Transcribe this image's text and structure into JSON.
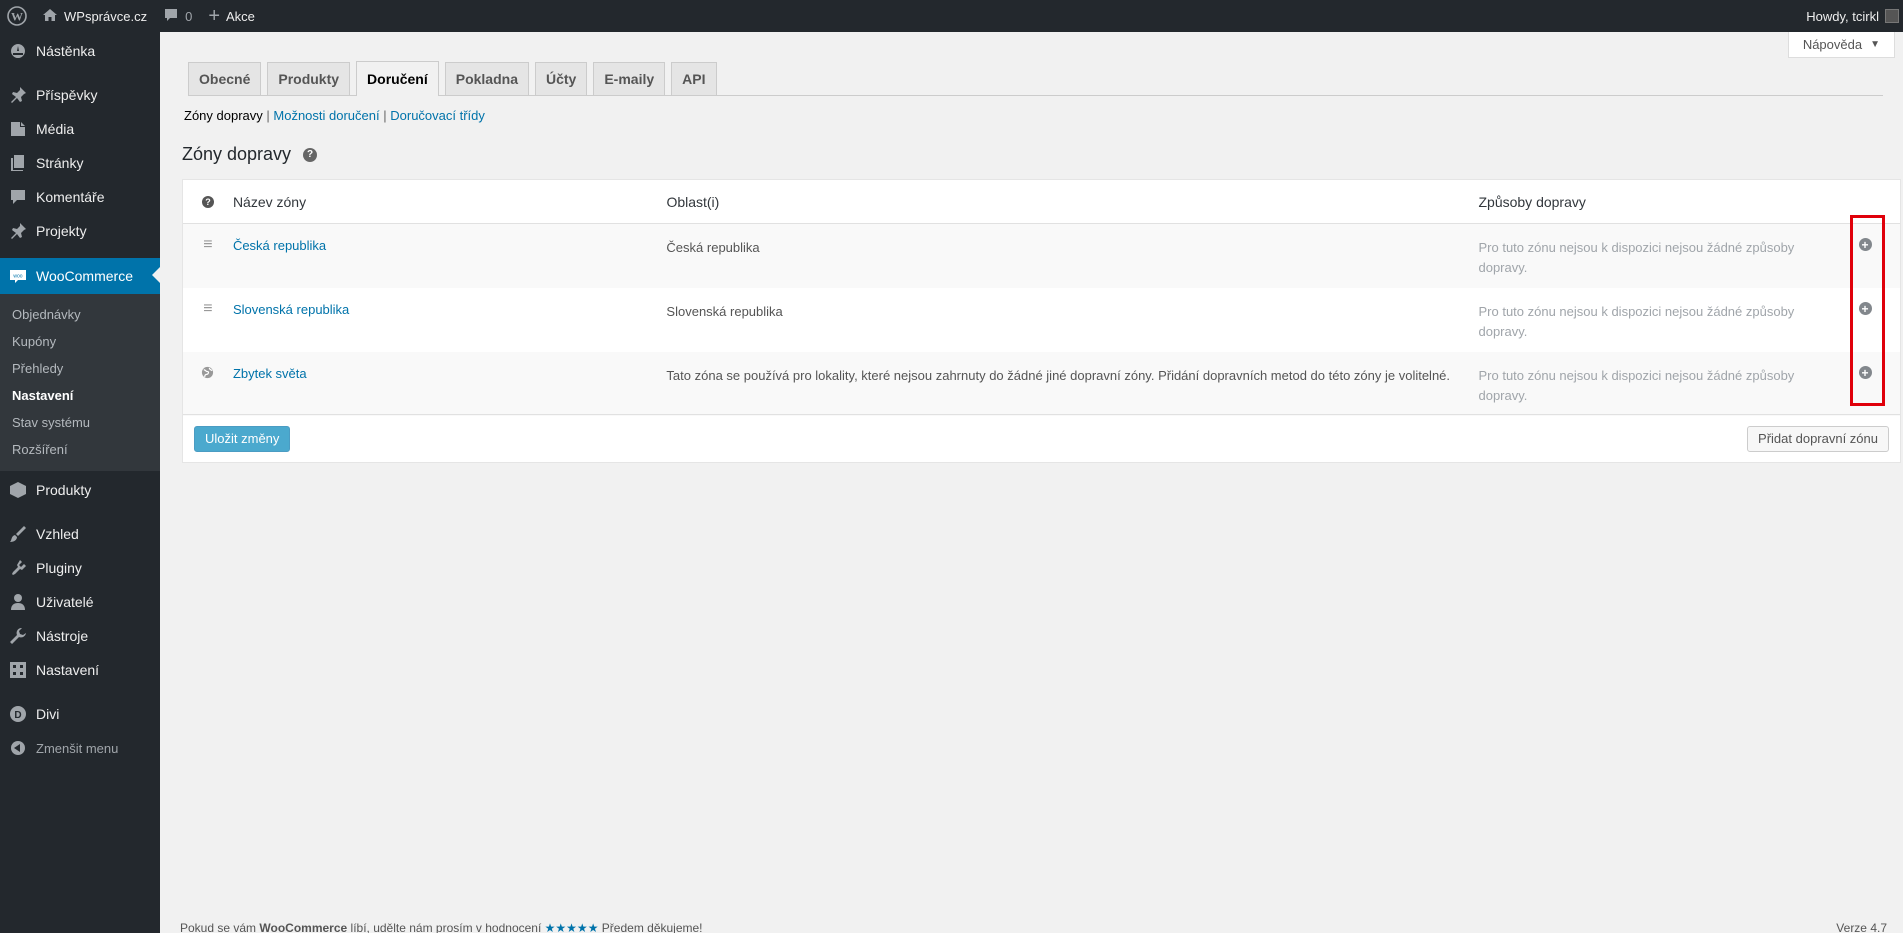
{
  "adminbar": {
    "site_name": "WPsprávce.cz",
    "comments_count": "0",
    "new_label": "Akce",
    "howdy": "Howdy, tcirkl"
  },
  "menu": {
    "items_top": [
      {
        "label": "Nástěnka",
        "icon": "dashboard-icon"
      },
      {
        "label": "Příspěvky",
        "icon": "pin-icon"
      },
      {
        "label": "Média",
        "icon": "media-icon"
      },
      {
        "label": "Stránky",
        "icon": "pages-icon"
      },
      {
        "label": "Komentáře",
        "icon": "comments-icon"
      },
      {
        "label": "Projekty",
        "icon": "pin-icon"
      },
      {
        "label": "WooCommerce",
        "icon": "woo-icon"
      }
    ],
    "submenu": [
      "Objednávky",
      "Kupóny",
      "Přehledy",
      "Nastavení",
      "Stav systému",
      "Rozšíření"
    ],
    "items_bottom": [
      {
        "label": "Produkty",
        "icon": "box-icon"
      },
      {
        "label": "Vzhled",
        "icon": "brush-icon"
      },
      {
        "label": "Pluginy",
        "icon": "plugin-icon"
      },
      {
        "label": "Uživatelé",
        "icon": "user-icon"
      },
      {
        "label": "Nástroje",
        "icon": "wrench-icon"
      },
      {
        "label": "Nastavení",
        "icon": "settings-icon"
      },
      {
        "label": "Divi",
        "icon": "divi-icon"
      },
      {
        "label": "Zmenšit menu",
        "icon": "collapse-icon"
      }
    ]
  },
  "help_tab": "Nápověda",
  "tabs": [
    "Obecné",
    "Produkty",
    "Doručení",
    "Pokladna",
    "Účty",
    "E-maily",
    "API"
  ],
  "subnav": {
    "current": "Zóny dopravy",
    "links": [
      "Možnosti doručení",
      "Doručovací třídy"
    ]
  },
  "page_title": "Zóny dopravy",
  "table": {
    "headers": {
      "name": "Název zóny",
      "region": "Oblast(i)",
      "methods": "Způsoby dopravy"
    },
    "rows": [
      {
        "name": "Česká republika",
        "region": "Česká republika",
        "methods": "Pro tuto zónu nejsou k dispozici nejsou žádné způsoby dopravy."
      },
      {
        "name": "Slovenská republika",
        "region": "Slovenská republika",
        "methods": "Pro tuto zónu nejsou k dispozici nejsou žádné způsoby dopravy."
      },
      {
        "name": "Zbytek světa",
        "region": "Tato zóna se používá pro lokality, které nejsou zahrnuty do žádné jiné dopravní zóny. Přidání dopravních metod do této zóny je volitelné.",
        "methods": "Pro tuto zónu nejsou k dispozici nejsou žádné způsoby dopravy."
      }
    ],
    "save_button": "Uložit změny",
    "add_zone_button": "Přidat dopravní zónu"
  },
  "footer": {
    "text_pre": "Pokud se vám",
    "brand": "WooCommerce",
    "text_mid": "líbí, udělte nám prosím v hodnocení",
    "stars": "★★★★★",
    "text_post": "Předem děkujeme!",
    "version": "Verze 4.7"
  },
  "colors": {
    "accent": "#0073aa",
    "highlight": "#e0000a",
    "sidebar": "#23282d"
  }
}
